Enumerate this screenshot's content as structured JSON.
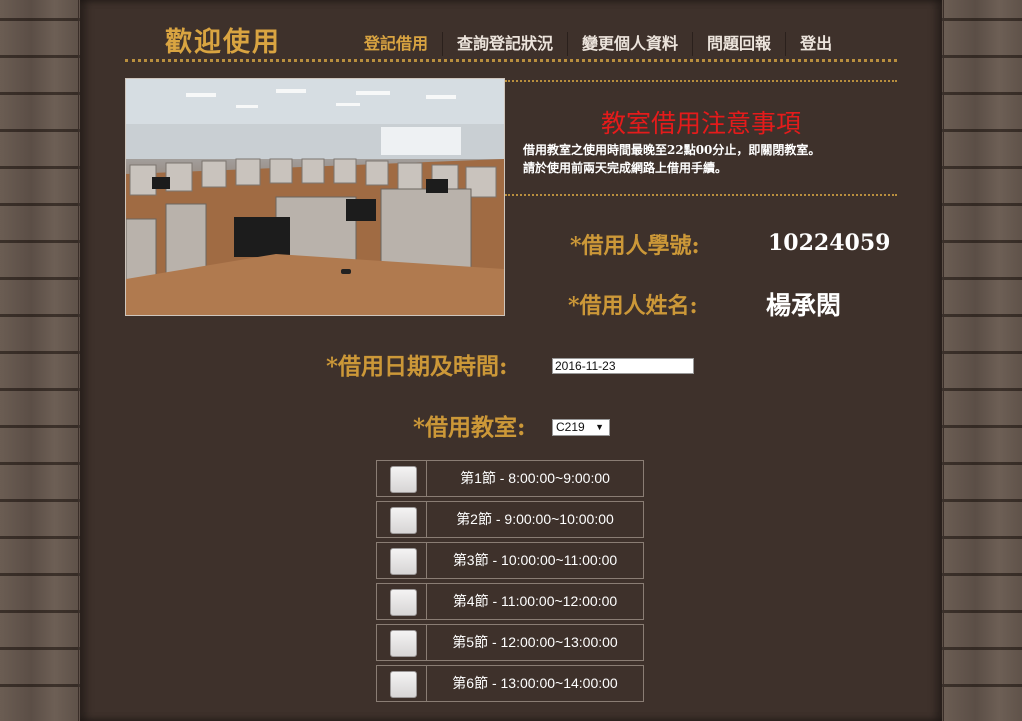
{
  "header": {
    "brand": "歡迎使用",
    "nav": [
      "登記借用",
      "查詢登記狀況",
      "變更個人資料",
      "問題回報",
      "登出"
    ]
  },
  "notice": {
    "title": "教室借用注意事項",
    "lines": [
      "借用教室之使用時間最晚至22點00分止，即關閉教室。",
      "請於使用前兩天完成網路上借用手續。"
    ]
  },
  "form": {
    "student_id_label": "*借用人學號:",
    "student_id_value": "10224059",
    "name_label": "*借用人姓名:",
    "name_value": "楊承閎",
    "datetime_label": "*借用日期及時間:",
    "date_value": "2016-11-23",
    "room_label": "*借用教室:",
    "room_value": "C219"
  },
  "periods": [
    {
      "label": "第1節 - 8:00:00~9:00:00",
      "checked": false
    },
    {
      "label": "第2節 - 9:00:00~10:00:00",
      "checked": false
    },
    {
      "label": "第3節 - 10:00:00~11:00:00",
      "checked": false
    },
    {
      "label": "第4節 - 11:00:00~12:00:00",
      "checked": false
    },
    {
      "label": "第5節 - 12:00:00~13:00:00",
      "checked": false
    },
    {
      "label": "第6節 - 13:00:00~14:00:00",
      "checked": false
    }
  ],
  "colors": {
    "gold": "#cc9838",
    "notice_red": "#e41b1b",
    "panel": "#3e312b"
  }
}
